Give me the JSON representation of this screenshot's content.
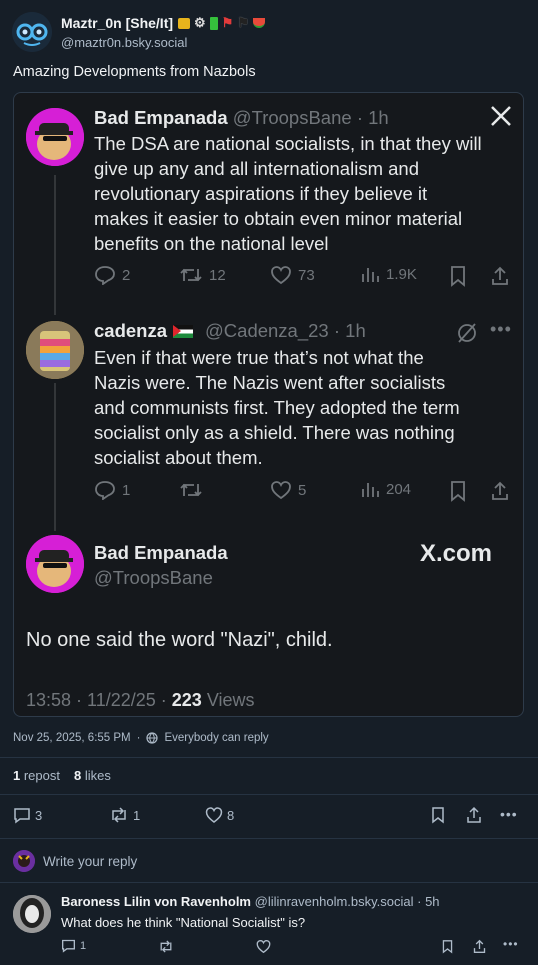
{
  "post": {
    "author_name": "Maztr_0n [She/It]",
    "author_handle": "@maztr0n.bsky.social",
    "text": "Amazing Developments from Nazbols",
    "date": "Nov 25, 2025, 6:55 PM",
    "reply_setting": "Everybody can reply",
    "repost_count": "1",
    "repost_label": " repost",
    "like_count": "8",
    "like_label": " likes",
    "actions": {
      "replies": "3",
      "reposts": "1",
      "likes": "8"
    }
  },
  "embed": {
    "tweet1": {
      "name": "Bad Empanada",
      "handle": "@TroopsBane · 1h",
      "lines": [
        "The DSA are national socialists, in that they will",
        "give up any and all internationalism and",
        "revolutionary aspirations if they believe it",
        "makes it easier to obtain even minor material",
        "benefits on the national level"
      ],
      "replies": "2",
      "retweets": "12",
      "likes": "73",
      "views": "1.9K"
    },
    "tweet2": {
      "name": "cadenza",
      "handle": "@Cadenza_23 · 1h",
      "lines": [
        "Even if that were true that’s not what the",
        "Nazis were. The Nazis went after socialists",
        "and communists first. They adopted the term",
        "socialist only as a shield. There was nothing",
        "socialist about them."
      ],
      "replies": "1",
      "retweets": "",
      "likes": "5",
      "views": "204"
    },
    "tweet3": {
      "name": "Bad Empanada",
      "handle": "@TroopsBane",
      "brand": "X.com",
      "text": "No one said the word \"Nazi\", child.",
      "timestamp": "13:58 · 11/22/25 · ",
      "views_count": "223",
      "views_label": " Views"
    }
  },
  "reply_box": {
    "placeholder": "Write your reply"
  },
  "reply": {
    "name": "Baroness Lilin von Ravenholm",
    "handle": "@lilinravenholm.bsky.social · 5h",
    "text": "What does he think \"National Socialist\" is?",
    "replies": "1"
  },
  "colors": {
    "background": "#161e27",
    "card": "#15181c",
    "muted": "#aebbc9",
    "tw_muted": "#71767b"
  }
}
